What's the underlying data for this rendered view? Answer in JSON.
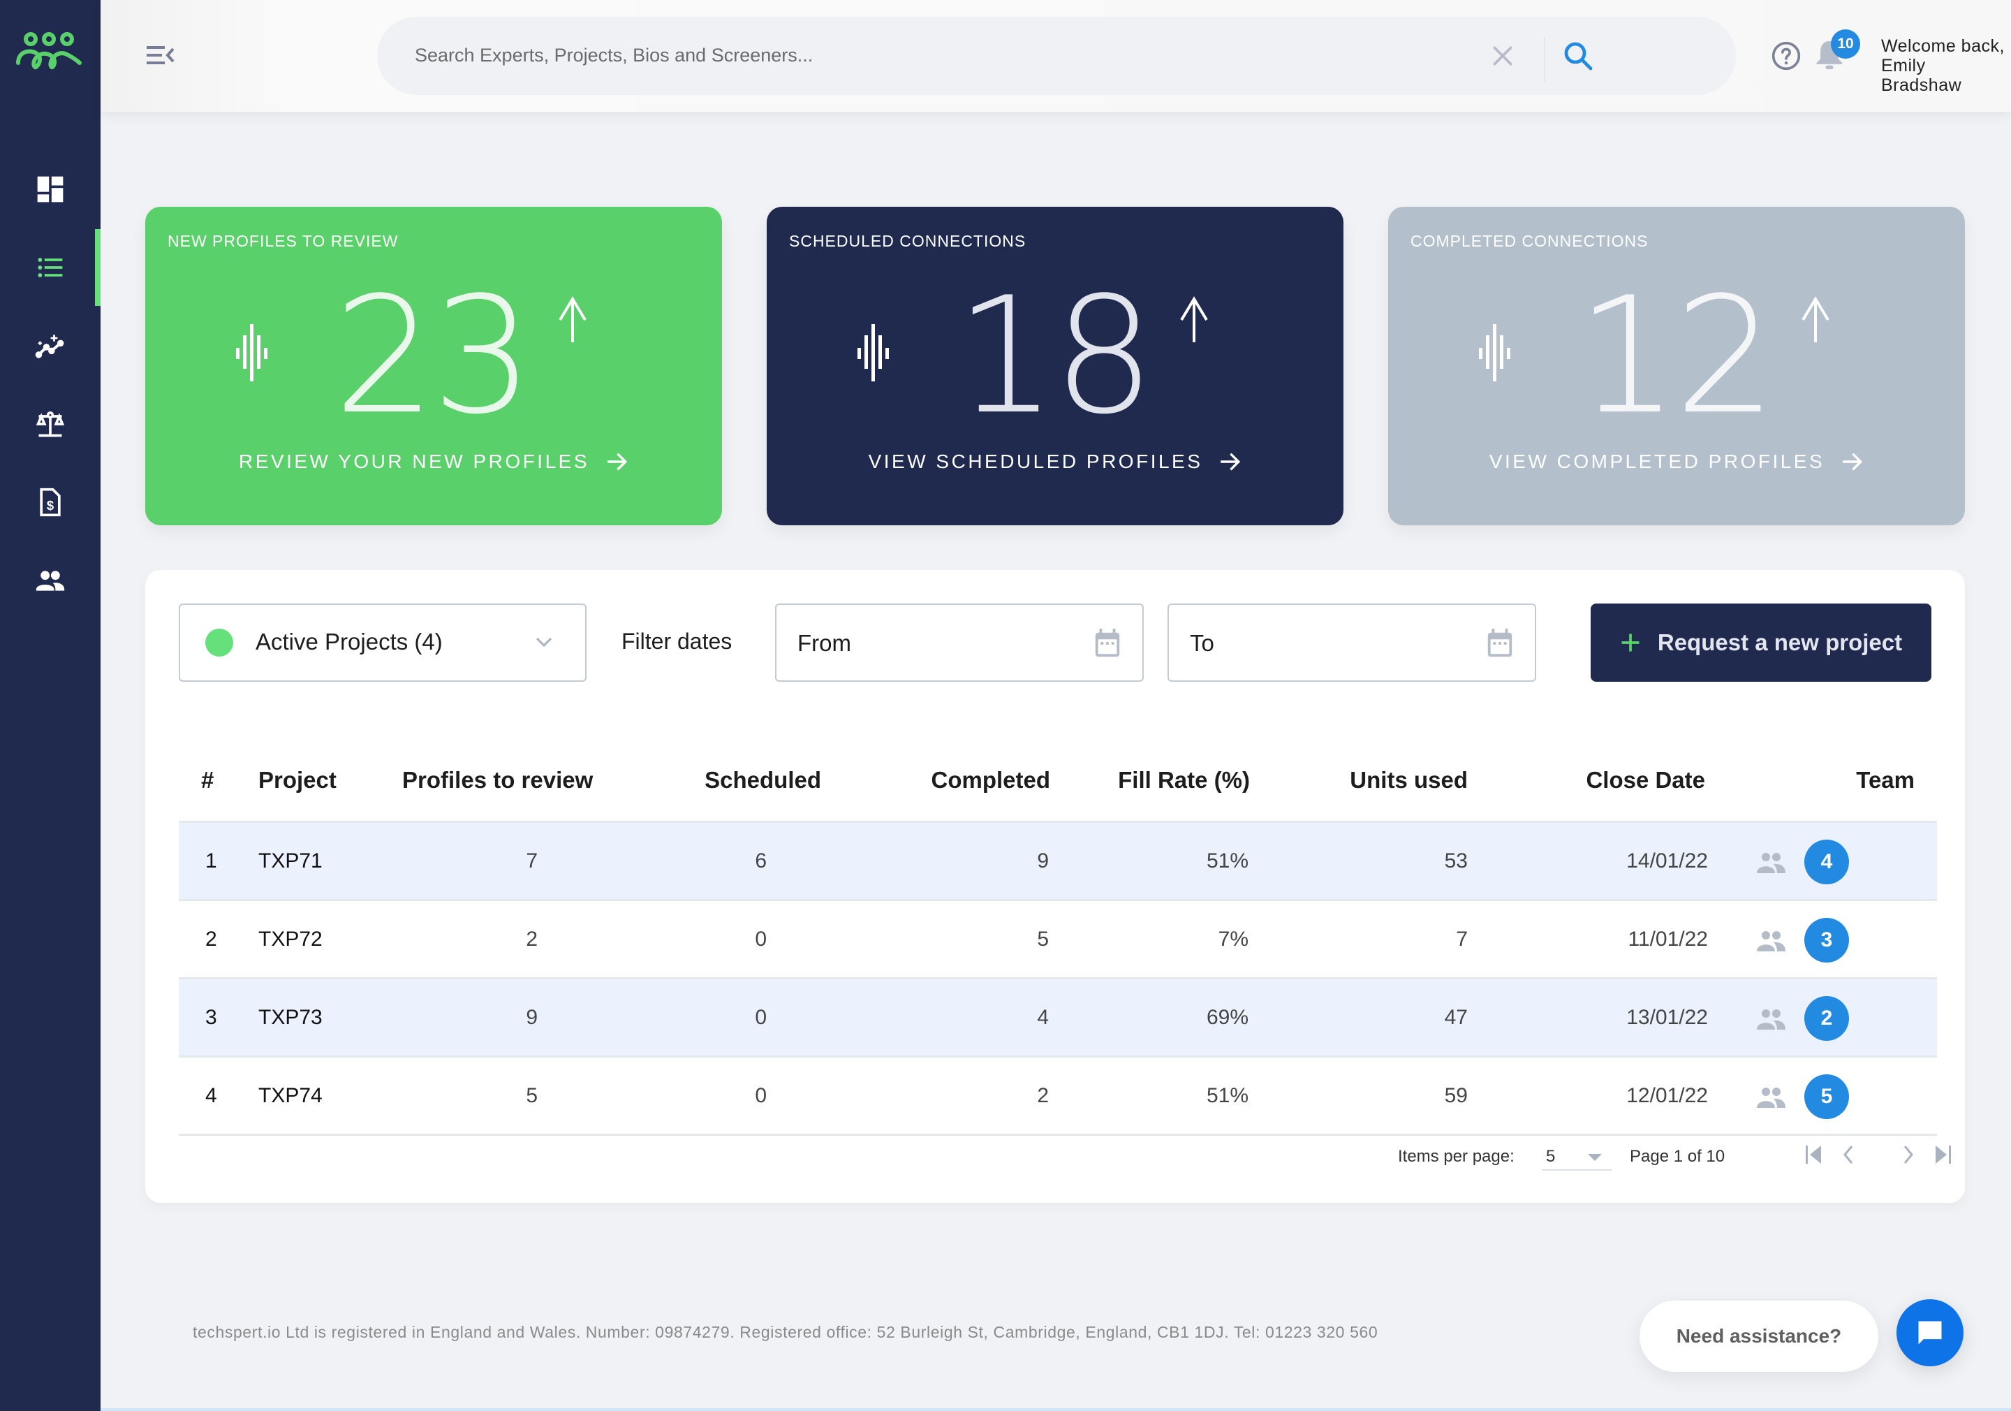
{
  "header": {
    "search_placeholder": "Search Experts, Projects, Bios and Screeners...",
    "notifications_count": "10",
    "welcome_line1": "Welcome back,",
    "welcome_line2": "Emily Bradshaw"
  },
  "sidebar": {
    "items": [
      {
        "name": "dashboard",
        "icon": "dashboard-icon",
        "active": false
      },
      {
        "name": "projects",
        "icon": "list-icon",
        "active": true
      },
      {
        "name": "insights",
        "icon": "sparkline-icon",
        "active": false
      },
      {
        "name": "compliance",
        "icon": "scales-icon",
        "active": false
      },
      {
        "name": "invoices",
        "icon": "invoice-dollar-icon",
        "active": false
      },
      {
        "name": "team",
        "icon": "people-icon",
        "active": false
      }
    ]
  },
  "cards": [
    {
      "title": "NEW PROFILES TO REVIEW",
      "value": "23",
      "link": "REVIEW YOUR NEW PROFILES",
      "color": "#5ad06b"
    },
    {
      "title": "SCHEDULED CONNECTIONS",
      "value": "18",
      "link": "VIEW SCHEDULED PROFILES",
      "color": "#1f2a4e"
    },
    {
      "title": "COMPLETED CONNECTIONS",
      "value": "12",
      "link": "VIEW COMPLETED PROFILES",
      "color": "#b4bfcc"
    }
  ],
  "filters": {
    "project_select": "Active Projects (4)",
    "filter_label": "Filter dates",
    "from_placeholder": "From",
    "to_placeholder": "To",
    "request_button": "Request a new project"
  },
  "table": {
    "headers": [
      "#",
      "Project",
      "Profiles to review",
      "Scheduled",
      "Completed",
      "Fill Rate (%)",
      "Units used",
      "Close Date",
      "Team"
    ],
    "rows": [
      {
        "idx": "1",
        "project": "TXP71",
        "profiles": "7",
        "scheduled": "6",
        "completed": "9",
        "fill_rate": "51%",
        "units": "53",
        "close_date": "14/01/22",
        "team": "4"
      },
      {
        "idx": "2",
        "project": "TXP72",
        "profiles": "2",
        "scheduled": "0",
        "completed": "5",
        "fill_rate": "7%",
        "units": "7",
        "close_date": "11/01/22",
        "team": "3"
      },
      {
        "idx": "3",
        "project": "TXP73",
        "profiles": "9",
        "scheduled": "0",
        "completed": "4",
        "fill_rate": "69%",
        "units": "47",
        "close_date": "13/01/22",
        "team": "2"
      },
      {
        "idx": "4",
        "project": "TXP74",
        "profiles": "5",
        "scheduled": "0",
        "completed": "2",
        "fill_rate": "51%",
        "units": "59",
        "close_date": "12/01/22",
        "team": "5"
      }
    ]
  },
  "pagination": {
    "items_per_page_label": "Items per page:",
    "items_per_page": "5",
    "page_text": "Page 1 of 10"
  },
  "footer": {
    "text": "techspert.io Ltd is registered in England and Wales. Number: 09874279. Registered office: 52 Burleigh St, Cambridge, England, CB1 1DJ. Tel: 01223 320 560",
    "assist_label": "Need assistance?"
  },
  "colors": {
    "brand_green": "#5ad06b",
    "navy": "#1f2a4e",
    "accent_blue": "#228ae0",
    "muted_grey": "#b4bfcc"
  }
}
